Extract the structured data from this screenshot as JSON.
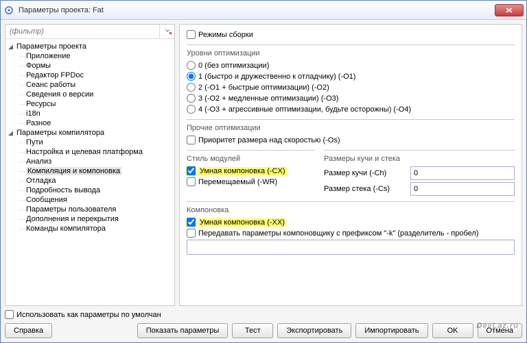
{
  "window": {
    "title": "Параметры проекта: Fat"
  },
  "filter": {
    "placeholder": "(фильтр)"
  },
  "tree": {
    "group1": "Параметры проекта",
    "items1": [
      "Приложение",
      "Формы",
      "Редактор FPDoc",
      "Сеанс работы",
      "Сведения о версии",
      "Ресурсы",
      "i18n",
      "Разное"
    ],
    "group2": "Параметры компилятора",
    "items2": [
      "Пути",
      "Настройка и целевая платформа",
      "Анализ",
      "Компиляция и компоновка",
      "Отладка",
      "Подробность вывода",
      "Сообщения",
      "Параметры пользователя",
      "Дополнения и перекрытия",
      "Команды компилятора"
    ]
  },
  "right": {
    "buildModes": "Режимы сборки",
    "optLevels": {
      "title": "Уровни оптимизации",
      "o0": "0 (без оптимизации)",
      "o1": "1 (быстро и дружественно к отладчику) (-O1)",
      "o2": "2 (-O1 + быстрые оптимизации) (-O2)",
      "o3": "3 (-O2 + медленные оптимизации) (-O3)",
      "o4": "4 (-O3 + агрессивные оптимизации, будьте осторожны) (-O4)"
    },
    "otherOpt": {
      "title": "Прочие оптимизации",
      "sizeOverSpeed": "Приоритет размера над скоростью (-Os)"
    },
    "unitStyle": {
      "title": "Стиль модулей",
      "smartLink": "Умная компоновка (-CX)",
      "relocatable": "Перемещаемый (-WR)"
    },
    "heapStack": {
      "title": "Размеры кучи и стека",
      "heapLabel": "Размер кучи (-Ch)",
      "stackLabel": "Размер стека (-Cs)",
      "heapVal": "0",
      "stackVal": "0"
    },
    "linking": {
      "title": "Компоновка",
      "smartLink": "Умная компоновка (-XX)",
      "passK": "Передавать параметры компоновщику с префиксом \"-k\" (разделитель - пробел)"
    }
  },
  "bottom": {
    "useAsDefault": "Использовать как параметры по умолчан"
  },
  "buttons": {
    "help": "Справка",
    "showOptions": "Показать параметры",
    "test": "Тест",
    "export": "Экспортировать",
    "import": "Импортировать",
    "ok": "OK",
    "cancel": "Отмена"
  },
  "watermark": {
    "pre": "D",
    "rest": "evLaz.ru"
  }
}
